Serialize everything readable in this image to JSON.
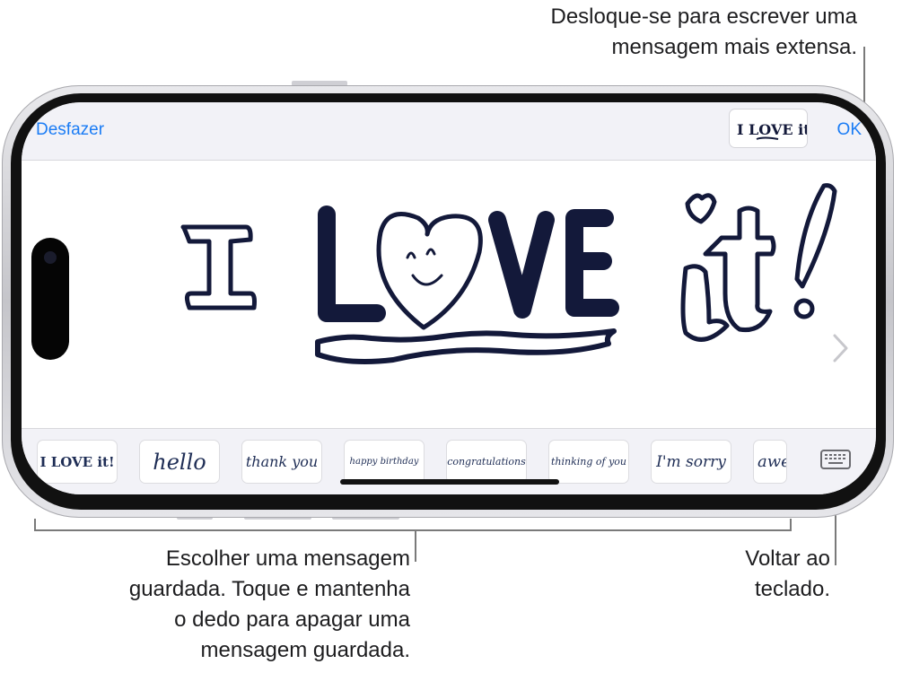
{
  "callouts": {
    "top": "Desloque-se para escrever uma\nmensagem mais extensa.",
    "left": "Escolher uma mensagem\nguardada. Toque e mantenha\no dedo para apagar uma\nmensagem guardada.",
    "right": "Voltar ao\nteclado."
  },
  "toolbar": {
    "undo_label": "Desfazer",
    "done_label": "OK"
  },
  "canvas": {
    "handwriting_text": "I LOVE it!"
  },
  "saved_messages": [
    {
      "text": "I LOVE it!"
    },
    {
      "text": "hello"
    },
    {
      "text": "thank you"
    },
    {
      "text": "happy birthday"
    },
    {
      "text": "congratulations"
    },
    {
      "text": "thinking of you"
    },
    {
      "text": "I'm sorry"
    },
    {
      "text": "awe"
    }
  ],
  "icons": {
    "next": "chevron-right-icon",
    "keyboard": "keyboard-icon"
  },
  "colors": {
    "accent": "#1a7cf5",
    "ink": "#13193a"
  }
}
